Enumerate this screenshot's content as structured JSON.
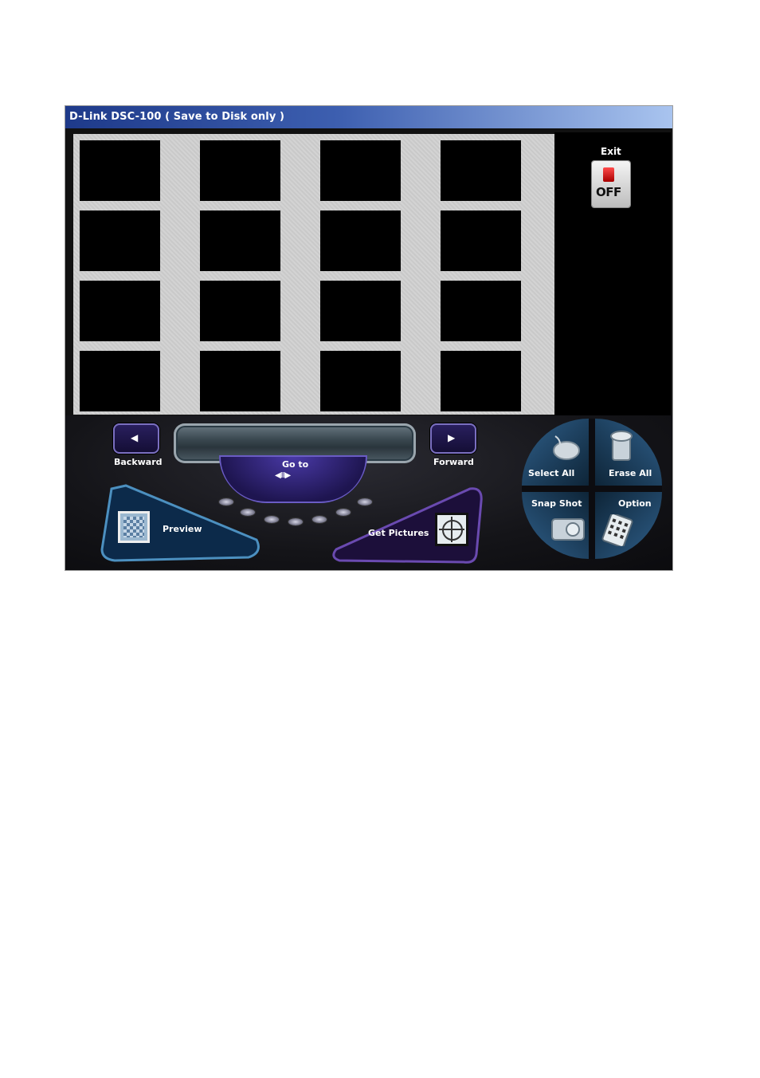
{
  "window": {
    "title": "D-Link DSC-100 ( Save to Disk only )"
  },
  "exit": {
    "label": "Exit",
    "switch_text": "OFF"
  },
  "navigation": {
    "backward_label": "Backward",
    "forward_label": "Forward",
    "goto_label": "Go to"
  },
  "actions": {
    "preview_label": "Preview",
    "get_pictures_label": "Get Pictures",
    "select_all_label": "Select All",
    "erase_all_label": "Erase All",
    "snap_shot_label": "Snap Shot",
    "option_label": "Option"
  },
  "thumbnails": {
    "rows": 4,
    "columns": 4
  },
  "colors": {
    "titlebar_start": "#1e3a8a",
    "titlebar_end": "#a9c4ef",
    "accent_purple": "#6a5cc4",
    "accent_blue": "#2f5f8a"
  }
}
